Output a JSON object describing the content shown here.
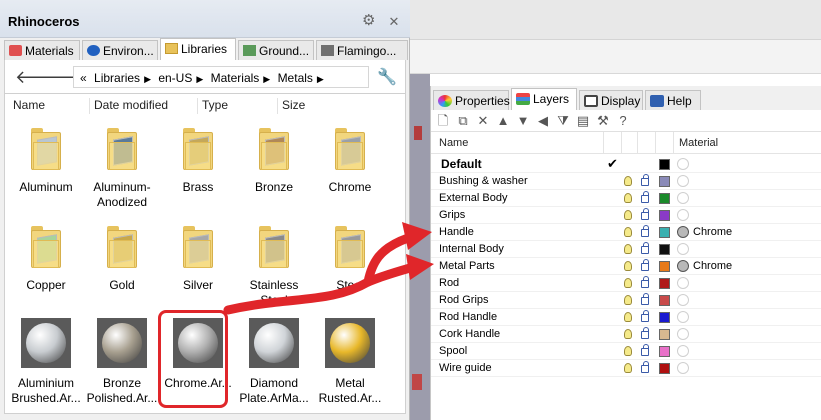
{
  "rhino_panel": {
    "title": "Rhinoceros",
    "tabs": [
      {
        "label": "Materials",
        "icon": "materials-icon",
        "color": "#e05050"
      },
      {
        "label": "Environ...",
        "icon": "environment-icon",
        "color": "#2060c0"
      },
      {
        "label": "Libraries",
        "icon": "folder-icon",
        "color": "#e8c25a"
      },
      {
        "label": "Ground...",
        "icon": "ground-icon",
        "color": "#5a9a5a"
      },
      {
        "label": "Flamingo...",
        "icon": "flamingo-icon",
        "color": "#707070"
      }
    ],
    "breadcrumb": [
      "«",
      "Libraries",
      "en-US",
      "Materials",
      "Metals"
    ],
    "columns": [
      "Name",
      "Date modified",
      "Type",
      "Size"
    ],
    "folders": [
      {
        "label": "Aluminum",
        "color": "#b8c6d2"
      },
      {
        "label": "Aluminum-\nAnodized",
        "color": "#5a7a9a"
      },
      {
        "label": "Brass",
        "color": "#c4a85a"
      },
      {
        "label": "Bronze",
        "color": "#b08858"
      },
      {
        "label": "Chrome",
        "color": "#9aa0a8"
      },
      {
        "label": "Copper",
        "color": "#a8d49a"
      },
      {
        "label": "Gold",
        "color": "#c8a84a"
      },
      {
        "label": "Silver",
        "color": "#a8a8a8"
      },
      {
        "label": "Stainless\nSteel",
        "color": "#8a8a8a"
      },
      {
        "label": "Steel",
        "color": "#9a9a9a"
      }
    ],
    "materials": [
      {
        "label": "Aluminium\nBrushed.Ar...",
        "color": "#c8ccd0"
      },
      {
        "label": "Bronze\nPolished.Ar...",
        "color": "#a8a090"
      },
      {
        "label": "Chrome.Ar...",
        "color": "#b0b0b0"
      },
      {
        "label": "Diamond\nPlate.ArMa...",
        "color": "#d0d4d8"
      },
      {
        "label": "Metal\nRusted.Ar...",
        "color": "#e8b82a"
      }
    ]
  },
  "layers_panel": {
    "tabs": [
      {
        "label": "Properties",
        "icon": "properties-icon"
      },
      {
        "label": "Layers",
        "icon": "layers-icon"
      },
      {
        "label": "Display",
        "icon": "display-icon"
      },
      {
        "label": "Help",
        "icon": "help-icon"
      }
    ],
    "header": {
      "name": "Name",
      "material": "Material"
    },
    "rows": [
      {
        "name": "Default",
        "current": "✔",
        "color": "#000000",
        "material": ""
      },
      {
        "name": "Bushing & washer",
        "color": "#8a8ab8",
        "material": ""
      },
      {
        "name": "External Body",
        "color": "#1a8a2a",
        "material": ""
      },
      {
        "name": "Grips",
        "color": "#8a3ac8",
        "material": ""
      },
      {
        "name": "Handle",
        "color": "#3ab0b0",
        "material": "Chrome"
      },
      {
        "name": "Internal Body",
        "color": "#101010",
        "material": ""
      },
      {
        "name": "Metal Parts",
        "color": "#e87a1a",
        "material": "Chrome"
      },
      {
        "name": "Rod",
        "color": "#b01a1a",
        "material": ""
      },
      {
        "name": "Rod Grips",
        "color": "#c84a4a",
        "material": ""
      },
      {
        "name": "Rod Handle",
        "color": "#1a1ad0",
        "material": ""
      },
      {
        "name": "Cork Handle",
        "color": "#d8b890",
        "material": ""
      },
      {
        "name": "Spool",
        "color": "#e870c8",
        "material": ""
      },
      {
        "name": "Wire guide",
        "color": "#b01010",
        "material": ""
      }
    ]
  },
  "annotation_color": "#e0262a"
}
